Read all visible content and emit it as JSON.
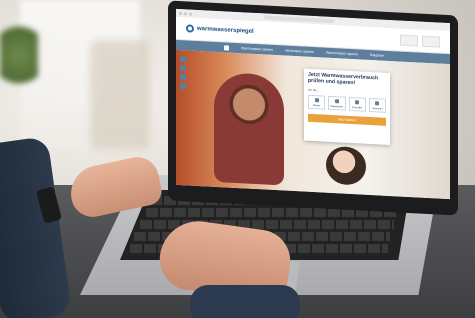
{
  "site": {
    "brand": "warmwasserspiegel",
    "nav": [
      "Warmwasser sparen",
      "Heizkosten sparen",
      "Warmwasser sparen",
      "Ratgeber"
    ],
    "card": {
      "title": "Jetzt Warmwasserverbrauch prüfen und sparen!",
      "label": "Ich bin...",
      "options": [
        "Mieter",
        "Eigentümer",
        "Verwalter",
        "Vermieter"
      ],
      "cta": "Jetzt starten"
    }
  },
  "icons": [
    "logo-icon",
    "home-icon"
  ]
}
